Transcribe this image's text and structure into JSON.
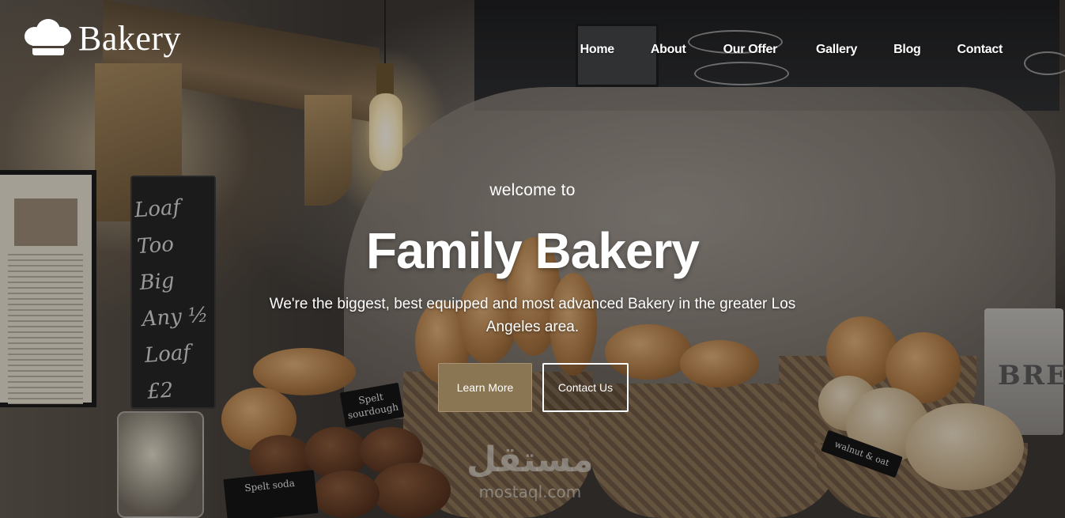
{
  "brand": {
    "name": "Bakery",
    "logo_icon": "chef-hat-icon"
  },
  "nav": {
    "items": [
      {
        "label": "Home"
      },
      {
        "label": "About"
      },
      {
        "label": "Our Offer"
      },
      {
        "label": "Gallery"
      },
      {
        "label": "Blog"
      },
      {
        "label": "Contact"
      }
    ]
  },
  "hero": {
    "welcome": "welcome to",
    "title": "Family Bakery",
    "tagline": "We're the biggest, best equipped and most advanced Bakery in the greater Los Angeles area.",
    "buttons": {
      "primary": "Learn More",
      "secondary": "Contact Us"
    }
  },
  "scene": {
    "chalkboard_text": [
      "Loaf Too",
      "Big",
      "Any ½",
      "Loaf £2"
    ],
    "tags": [
      "Spelt sourdough",
      "Spelt soda",
      "walnut & oat"
    ],
    "bin_label": "BRE"
  },
  "watermark": {
    "arabic": "مستقل",
    "latin": "mostaql.com"
  },
  "colors": {
    "primary_button": "#8b7654",
    "text": "#ffffff"
  }
}
